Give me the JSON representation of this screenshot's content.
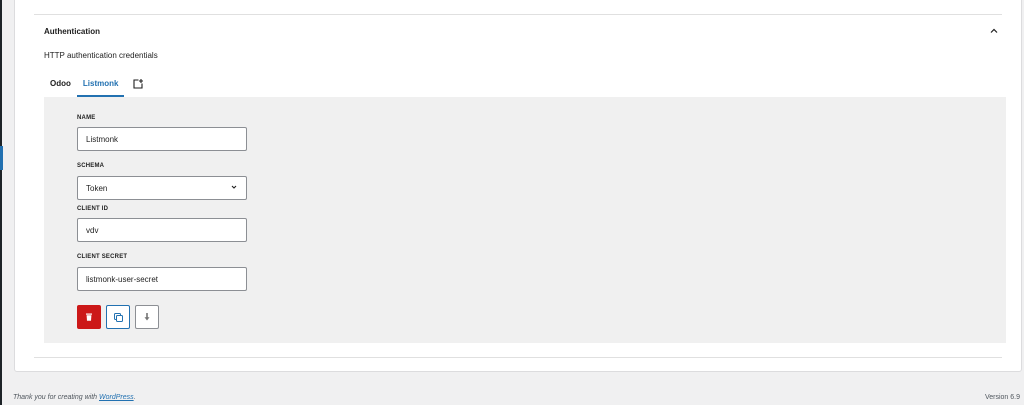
{
  "panel": {
    "title": "Authentication",
    "description": "HTTP authentication credentials"
  },
  "tabs": [
    {
      "label": "Odoo",
      "active": false
    },
    {
      "label": "Listmonk",
      "active": true
    }
  ],
  "form": {
    "name_label": "NAME",
    "name_value": "Listmonk",
    "schema_label": "SCHEMA",
    "schema_value": "Token",
    "client_id_label": "CLIENT ID",
    "client_id_value": "vdv",
    "client_secret_label": "CLIENT SECRET",
    "client_secret_value": "listmonk-user-secret"
  },
  "footer": {
    "thanks_prefix": "Thank you for creating with ",
    "thanks_link": "WordPress",
    "thanks_suffix": ".",
    "version": "Version 6.9"
  },
  "colors": {
    "accent": "#2271b1",
    "danger": "#cc1818",
    "form_background": "#f0f0f0"
  },
  "icons": {
    "collapse": "chevron-up-icon",
    "add_tab": "add-tab-icon",
    "delete": "trash-icon",
    "copy": "copy-icon",
    "download": "download-icon",
    "select": "chevron-down-icon"
  }
}
